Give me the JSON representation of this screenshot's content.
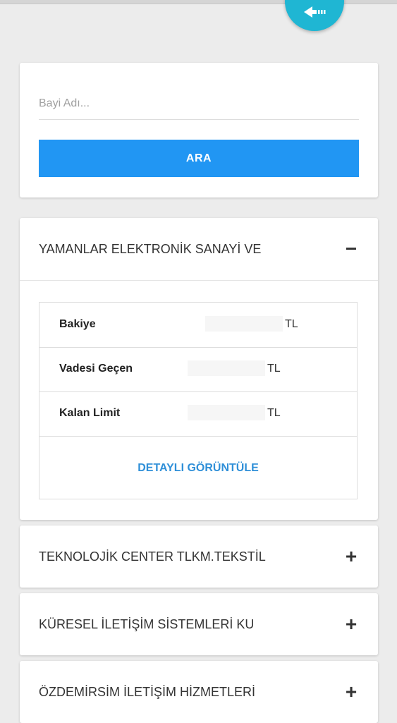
{
  "search": {
    "placeholder": "Bayi Adı...",
    "button_label": "ARA"
  },
  "dealers": [
    {
      "name": "YAMANLAR ELEKTRONİK SANAYİ VE",
      "toggle": "−",
      "expanded": true,
      "rows": [
        {
          "label": "Bakiye",
          "currency": "TL"
        },
        {
          "label": "Vadesi Geçen",
          "currency": "TL"
        },
        {
          "label": "Kalan Limit",
          "currency": "TL"
        }
      ],
      "detail_link": "DETAYLI GÖRÜNTÜLE"
    },
    {
      "name": "TEKNOLOJİK CENTER TLKM.TEKSTİL",
      "toggle": "+",
      "expanded": false
    },
    {
      "name": "KÜRESEL İLETİŞİM SİSTEMLERİ KU",
      "toggle": "+",
      "expanded": false
    },
    {
      "name": "ÖZDEMİRSİM İLETİŞİM HİZMETLERİ",
      "toggle": "+",
      "expanded": false
    }
  ],
  "colors": {
    "primary": "#2196f3",
    "fab": "#1fb6d3",
    "link": "#2f8fd8",
    "background": "#ececec"
  },
  "icons": {
    "fab": "back-arrow-icon"
  }
}
